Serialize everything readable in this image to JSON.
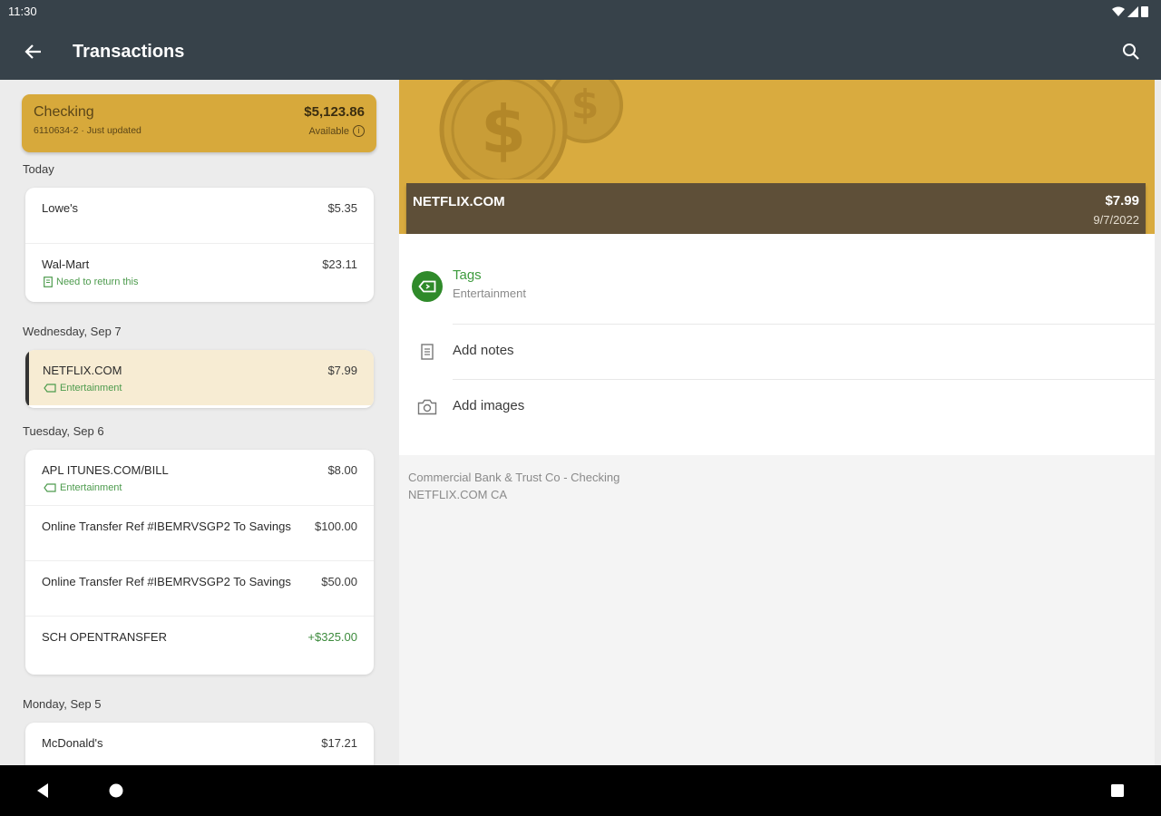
{
  "status": {
    "time": "11:30"
  },
  "appbar": {
    "title": "Transactions"
  },
  "account": {
    "name": "Checking",
    "number": "6110634-2 · Just updated",
    "balance": "$5,123.86",
    "available": "Available"
  },
  "sections": {
    "today": "Today",
    "sep7": "Wednesday, Sep 7",
    "sep6": "Tuesday, Sep 6",
    "sep5": "Monday, Sep 5"
  },
  "today": [
    {
      "merchant": "Lowe's",
      "amount": "$5.35"
    },
    {
      "merchant": "Wal-Mart",
      "amount": "$23.11",
      "note": "Need to return this"
    }
  ],
  "sep7": [
    {
      "merchant": "NETFLIX.COM",
      "amount": "$7.99",
      "tag": "Entertainment"
    }
  ],
  "sep6": [
    {
      "merchant": "APL ITUNES.COM/BILL",
      "amount": "$8.00",
      "tag": "Entertainment"
    },
    {
      "merchant": "Online Transfer Ref #IBEMRVSGP2 To Savings",
      "amount": "$100.00"
    },
    {
      "merchant": "Online Transfer Ref #IBEMRVSGP2 To Savings",
      "amount": "$50.00"
    },
    {
      "merchant": "SCH OPENTRANSFER",
      "amount": "+$325.00"
    }
  ],
  "sep5": [
    {
      "merchant": "McDonald's",
      "amount": "$17.21"
    }
  ],
  "detail": {
    "merchant": "NETFLIX.COM",
    "amount": "$7.99",
    "date": "9/7/2022",
    "tags_label": "Tags",
    "tags_value": "Entertainment",
    "notes_label": "Add notes",
    "images_label": "Add images",
    "account_line": "Commercial Bank & Trust Co - Checking",
    "raw_description": "NETFLIX.COM CA"
  },
  "colors": {
    "appbar": "#37424a",
    "accent_gold": "#d9ab3f",
    "tag_green": "#2f8a2a",
    "selected_row": "#f7ecd3"
  }
}
